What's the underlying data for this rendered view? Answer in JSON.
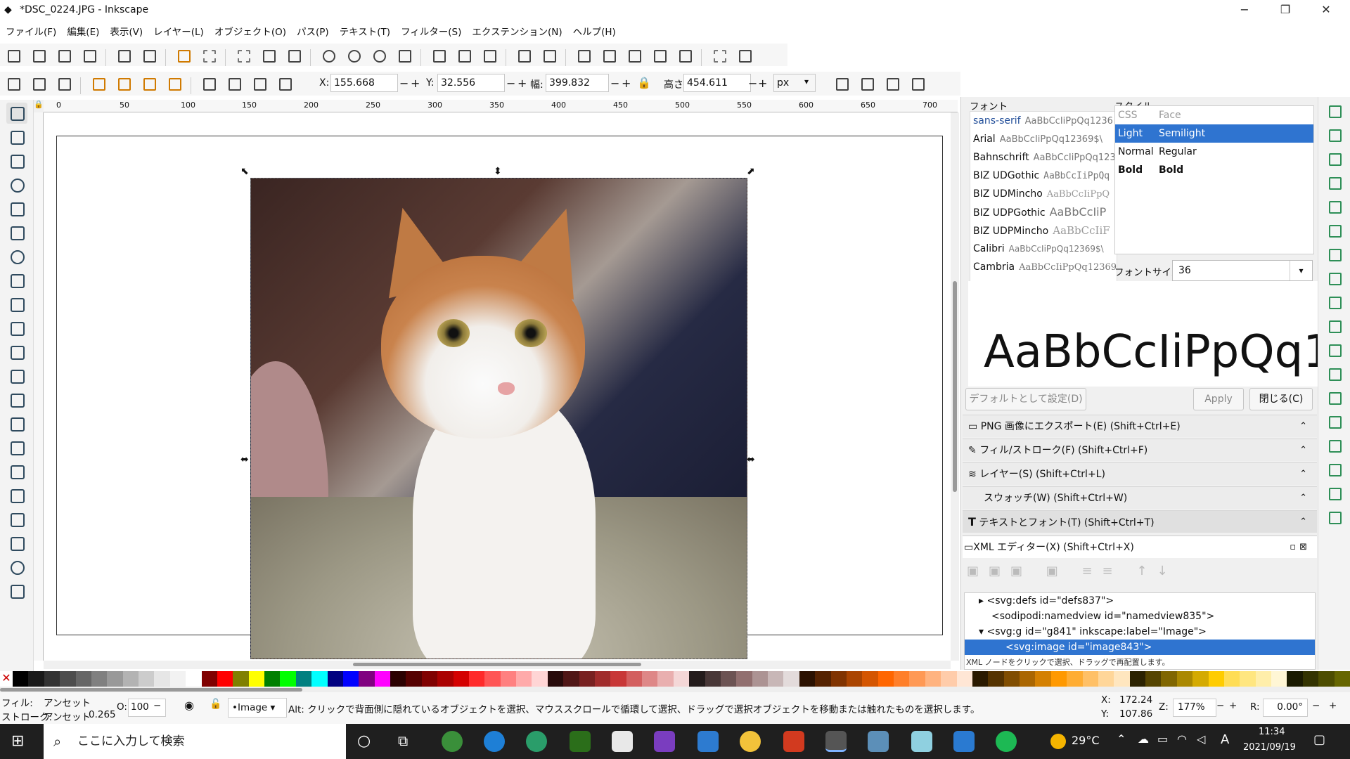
{
  "window": {
    "title": "*DSC_0224.JPG - Inkscape",
    "minimize": "−",
    "maximize": "❐",
    "close": "✕"
  },
  "menu": [
    "ファイル(F)",
    "編集(E)",
    "表示(V)",
    "レイヤー(L)",
    "オブジェクト(O)",
    "パス(P)",
    "テキスト(T)",
    "フィルター(S)",
    "エクステンション(N)",
    "ヘルプ(H)"
  ],
  "transform": {
    "x_label": "X:",
    "x": "155.668",
    "y_label": "Y:",
    "y": "32.556",
    "w_label": "幅:",
    "w": "399.832",
    "h_label": "高さ:",
    "h": "454.611",
    "unit": "px",
    "minus": "−",
    "plus": "+"
  },
  "ruler_ticks": [
    "0",
    "50",
    "100",
    "150",
    "200",
    "250",
    "300",
    "350",
    "400",
    "450",
    "500",
    "550",
    "600",
    "650",
    "700"
  ],
  "font_panel": {
    "font_label": "フォント",
    "style_label": "スタイル",
    "fonts": [
      {
        "name": "sans-serif",
        "sample": "AaBbCcIiPpQq1236"
      },
      {
        "name": "Arial",
        "sample": "AaBbCcIiPpQq12369$\\"
      },
      {
        "name": "Bahnschrift",
        "sample": "AaBbCcIiPpQq123"
      },
      {
        "name": "BIZ UDGothic",
        "sample": "AaBbCcIiPpQq"
      },
      {
        "name": "BIZ UDMincho",
        "sample": "AaBbCcIiPpQ"
      },
      {
        "name": "BIZ UDPGothic",
        "sample": "AaBbCcIiP"
      },
      {
        "name": "BIZ UDPMincho",
        "sample": "AaBbCcIiF"
      },
      {
        "name": "Calibri",
        "sample": "AaBbCcIiPpQq12369$\\"
      },
      {
        "name": "Cambria",
        "sample": "AaBbCcIiPpQq12369"
      }
    ],
    "style_header": {
      "css": "CSS",
      "face": "Face"
    },
    "styles": [
      {
        "css": "Light",
        "face": "Semilight"
      },
      {
        "css": "Normal",
        "face": "Regular"
      },
      {
        "css": "Bold",
        "face": "Bold"
      }
    ],
    "size_label": "フォントサイズ",
    "size": "36",
    "preview": "AaBbCcIiPpQq1...",
    "default_button": "デフォルトとして設定(D)",
    "apply_button": "Apply",
    "close_button": "閉じる(C)"
  },
  "docks": [
    {
      "label": "PNG 画像にエクスポート(E) (Shift+Ctrl+E)",
      "arrow": "⌃"
    },
    {
      "label": "フィル/ストローク(F) (Shift+Ctrl+F)",
      "arrow": "⌃"
    },
    {
      "label": "レイヤー(S) (Shift+Ctrl+L)",
      "arrow": "⌃"
    },
    {
      "label": "スウォッチ(W) (Shift+Ctrl+W)",
      "arrow": "⌃"
    },
    {
      "label": "テキストとフォント(T) (Shift+Ctrl+T)",
      "arrow": "⌃"
    }
  ],
  "xml_editor": {
    "title": "XML エディター(X) (Shift+Ctrl+X)",
    "nodes": [
      {
        "text": "<svg:defs id=\"defs837\">",
        "indent": 2,
        "arrow": "▸"
      },
      {
        "text": "<sodipodi:namedview id=\"namedview835\">",
        "indent": 2,
        "arrow": ""
      },
      {
        "text": "<svg:g id=\"g841\" inkscape:label=\"Image\">",
        "indent": 2,
        "arrow": "▾"
      },
      {
        "text": "<svg:image id=\"image843\">",
        "indent": 3,
        "arrow": ""
      }
    ],
    "hint": "XML ノードをクリックで選択、ドラッグで再配置します。"
  },
  "status": {
    "fill_label": "フィル:",
    "fill": "アンセット",
    "stroke_label": "ストローク:",
    "stroke": "アンセット",
    "stroke_width": "0.265",
    "opacity_label": "O:",
    "opacity": "100",
    "layer": "•Image",
    "message": "Alt: クリックで背面側に隠れているオブジェクトを選択、マウススクロールで循環して選択、ドラッグで選択オブジェクトを移動または触れたものを選択します。",
    "cursor_x_label": "X:",
    "cursor_x": "172.24",
    "cursor_y_label": "Y:",
    "cursor_y": "107.86",
    "zoom_label": "Z:",
    "zoom": "177%",
    "rotate_label": "R:",
    "rotate": "0.00°"
  },
  "taskbar": {
    "search_placeholder": "ここに入力して検索",
    "temperature": "29°C",
    "time": "11:34",
    "date": "2021/09/19",
    "ime": "A"
  },
  "colors": {
    "accent": "#2f74d0",
    "palette": [
      "#000000",
      "#1a1a1a",
      "#333333",
      "#4d4d4d",
      "#666666",
      "#808080",
      "#999999",
      "#b3b3b3",
      "#cccccc",
      "#e6e6e6",
      "#f2f2f2",
      "#ffffff",
      "#800000",
      "#ff0000",
      "#808000",
      "#ffff00",
      "#008000",
      "#00ff00",
      "#008080",
      "#00ffff",
      "#000080",
      "#0000ff",
      "#800080",
      "#ff00ff",
      "#2b0000",
      "#550000",
      "#800000",
      "#aa0000",
      "#d40000",
      "#ff2a2a",
      "#ff5555",
      "#ff8080",
      "#ffaaaa",
      "#ffd5d5",
      "#280b0b",
      "#501616",
      "#782121",
      "#a02c2c",
      "#c83737",
      "#d35f5f",
      "#de8787",
      "#e9afaf",
      "#f4d7d7",
      "#241c1c",
      "#483737",
      "#6c5353",
      "#916f6f",
      "#ac9393",
      "#c8b7b7",
      "#e3dbdb",
      "#2b1100",
      "#552200",
      "#803300",
      "#aa4400",
      "#d45500",
      "#ff6600",
      "#ff7f2a",
      "#ff9955",
      "#ffb380",
      "#ffccaa",
      "#ffe6d5",
      "#2b1a00",
      "#553300",
      "#804d00",
      "#aa6600",
      "#d48000",
      "#ff9900",
      "#ffad33",
      "#ffc066",
      "#ffd699",
      "#ffe6bf",
      "#2b2200",
      "#554400",
      "#806600",
      "#aa8800",
      "#d4aa00",
      "#ffcc00",
      "#ffdd55",
      "#ffe680",
      "#ffeeaa",
      "#fff6d5",
      "#1a1a00",
      "#333300",
      "#4d4d00",
      "#666600"
    ]
  }
}
